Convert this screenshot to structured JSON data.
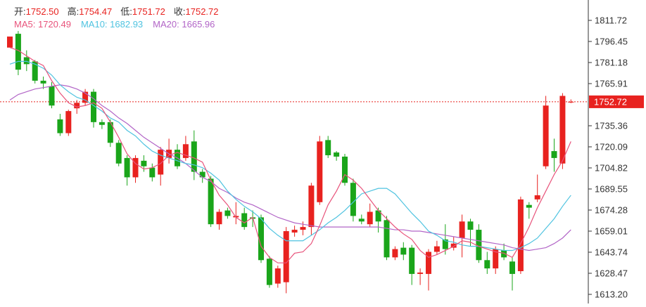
{
  "legend": {
    "open_label": "开:",
    "open_value": "1752.50",
    "high_label": "高:",
    "high_value": "1754.47",
    "low_label": "低:",
    "low_value": "1751.72",
    "close_label": "收:",
    "close_value": "1752.72"
  },
  "ma_legend": [
    {
      "label": "MA5:",
      "value": "1720.49",
      "color": "#e8537b"
    },
    {
      "label": "MA10:",
      "value": "1682.93",
      "color": "#4fc3e0"
    },
    {
      "label": "MA20:",
      "value": "1665.96",
      "color": "#b265c7"
    }
  ],
  "colors": {
    "up": "#e8221f",
    "down": "#1aa51a",
    "last_price_line": "#e8221f",
    "axis": "#333333"
  },
  "chart_data": {
    "type": "candlestick",
    "ylim": [
      1608,
      1822
    ],
    "yticks": [
      1811.72,
      1796.45,
      1781.18,
      1765.91,
      1735.36,
      1720.09,
      1704.82,
      1689.55,
      1674.28,
      1659.01,
      1643.74,
      1628.47,
      1613.2
    ],
    "last_price": 1752.72,
    "last_price_label": "1752.72",
    "candles": [
      [
        1792,
        1800,
        1790,
        1790
      ],
      [
        1802,
        1776,
        1804,
        1772
      ],
      [
        1785,
        1780,
        1790,
        1775
      ],
      [
        1782,
        1768,
        1783,
        1766
      ],
      [
        1768,
        1766,
        1771,
        1762
      ],
      [
        1764,
        1750,
        1767,
        1748
      ],
      [
        1740,
        1730,
        1744,
        1728
      ],
      [
        1730,
        1746,
        1747,
        1728
      ],
      [
        1748,
        1752,
        1754,
        1744
      ],
      [
        1752,
        1760,
        1762,
        1750
      ],
      [
        1760,
        1738,
        1762,
        1734
      ],
      [
        1738,
        1736,
        1740,
        1733
      ],
      [
        1738,
        1723,
        1740,
        1720
      ],
      [
        1723,
        1708,
        1725,
        1706
      ],
      [
        1712,
        1698,
        1714,
        1692
      ],
      [
        1698,
        1712,
        1714,
        1694
      ],
      [
        1710,
        1706,
        1714,
        1702
      ],
      [
        1705,
        1698,
        1708,
        1695
      ],
      [
        1700,
        1718,
        1720,
        1692
      ],
      [
        1712,
        1718,
        1726,
        1708
      ],
      [
        1718,
        1706,
        1722,
        1704
      ],
      [
        1712,
        1722,
        1728,
        1710
      ],
      [
        1724,
        1702,
        1732,
        1696
      ],
      [
        1702,
        1698,
        1704,
        1694
      ],
      [
        1697,
        1664,
        1699,
        1662
      ],
      [
        1664,
        1673,
        1675,
        1660
      ],
      [
        1674,
        1670,
        1676,
        1668
      ],
      [
        1669,
        1670,
        1680,
        1664
      ],
      [
        1672,
        1662,
        1676,
        1660
      ],
      [
        1669,
        1668,
        1674,
        1662
      ],
      [
        1669,
        1638,
        1671,
        1636
      ],
      [
        1639,
        1620,
        1641,
        1618
      ],
      [
        1621,
        1632,
        1634,
        1618
      ],
      [
        1622,
        1659,
        1662,
        1614
      ],
      [
        1658,
        1660,
        1663,
        1655
      ],
      [
        1660,
        1662,
        1666,
        1656
      ],
      [
        1662,
        1692,
        1694,
        1656
      ],
      [
        1680,
        1724,
        1728,
        1678
      ],
      [
        1725,
        1714,
        1728,
        1712
      ],
      [
        1716,
        1713,
        1717,
        1710
      ],
      [
        1713,
        1694,
        1715,
        1692
      ],
      [
        1694,
        1670,
        1697,
        1666
      ],
      [
        1668,
        1666,
        1671,
        1664
      ],
      [
        1664,
        1673,
        1679,
        1662
      ],
      [
        1674,
        1666,
        1676,
        1658
      ],
      [
        1667,
        1640,
        1670,
        1638
      ],
      [
        1640,
        1646,
        1648,
        1638
      ],
      [
        1647,
        1642,
        1651,
        1638
      ],
      [
        1647,
        1628,
        1649,
        1620
      ],
      [
        1628,
        1629,
        1632,
        1620
      ],
      [
        1628,
        1644,
        1646,
        1616
      ],
      [
        1644,
        1648,
        1652,
        1642
      ],
      [
        1653,
        1646,
        1664,
        1642
      ],
      [
        1647,
        1650,
        1655,
        1645
      ],
      [
        1654,
        1666,
        1671,
        1640
      ],
      [
        1666,
        1660,
        1668,
        1648
      ],
      [
        1660,
        1638,
        1664,
        1636
      ],
      [
        1638,
        1632,
        1644,
        1628
      ],
      [
        1632,
        1646,
        1648,
        1628
      ],
      [
        1645,
        1640,
        1650,
        1638
      ],
      [
        1637,
        1628,
        1640,
        1616
      ],
      [
        1630,
        1682,
        1684,
        1628
      ],
      [
        1678,
        1676,
        1680,
        1668
      ],
      [
        1682,
        1685,
        1700,
        1680
      ],
      [
        1706,
        1750,
        1757,
        1704
      ],
      [
        1717,
        1712,
        1726,
        1702
      ],
      [
        1708,
        1757,
        1759,
        1704
      ],
      [
        1752.5,
        1752.72,
        1754.47,
        1751.72
      ]
    ],
    "ma5": [
      1792,
      1790,
      1786,
      1782,
      1779,
      1768,
      1759,
      1752,
      1749,
      1750,
      1752,
      1748,
      1738,
      1727,
      1715,
      1708,
      1704,
      1705,
      1708,
      1714,
      1716,
      1714,
      1712,
      1709,
      1696,
      1685,
      1678,
      1669,
      1665,
      1669,
      1648,
      1640,
      1636,
      1636,
      1643,
      1644,
      1650,
      1663,
      1678,
      1688,
      1700,
      1696,
      1690,
      1682,
      1674,
      1668,
      1662,
      1657,
      1653,
      1645,
      1640,
      1642,
      1645,
      1648,
      1652,
      1651,
      1648,
      1646,
      1644,
      1643,
      1640,
      1650,
      1662,
      1676,
      1688,
      1700,
      1710,
      1724
    ],
    "ma10": [
      1780,
      1782,
      1782,
      1780,
      1777,
      1772,
      1765,
      1760,
      1756,
      1754,
      1750,
      1746,
      1741,
      1738,
      1732,
      1728,
      1722,
      1717,
      1714,
      1712,
      1710,
      1708,
      1707,
      1705,
      1701,
      1696,
      1688,
      1682,
      1677,
      1673,
      1668,
      1661,
      1656,
      1652,
      1652,
      1652,
      1656,
      1660,
      1665,
      1669,
      1674,
      1680,
      1686,
      1688,
      1690,
      1690,
      1686,
      1679,
      1672,
      1666,
      1659,
      1656,
      1652,
      1651,
      1649,
      1648,
      1648,
      1647,
      1646,
      1645,
      1645,
      1647,
      1650,
      1654,
      1661,
      1668,
      1677,
      1685
    ],
    "ma20": [
      1754,
      1758,
      1760,
      1762,
      1763,
      1764,
      1765,
      1764,
      1762,
      1759,
      1755,
      1750,
      1746,
      1741,
      1737,
      1732,
      1727,
      1723,
      1719,
      1715,
      1712,
      1708,
      1703,
      1698,
      1695,
      1690,
      1687,
      1683,
      1680,
      1678,
      1675,
      1672,
      1669,
      1667,
      1665,
      1664,
      1663,
      1662,
      1662,
      1662,
      1662,
      1662,
      1662,
      1662,
      1662,
      1661,
      1660,
      1660,
      1659,
      1659,
      1658,
      1657,
      1656,
      1655,
      1654,
      1653,
      1652,
      1651,
      1650,
      1649,
      1647,
      1646,
      1645,
      1646,
      1647,
      1650,
      1654,
      1660
    ]
  }
}
